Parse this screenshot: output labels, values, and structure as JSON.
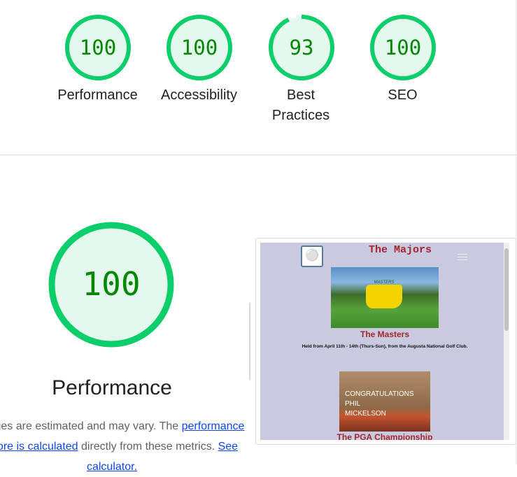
{
  "colors": {
    "pass": "#0cce6b",
    "pass_fill": "#e5f8ed",
    "pass_text": "#008800",
    "link": "#0d47f0"
  },
  "summary": [
    {
      "label": "Performance",
      "score": 100
    },
    {
      "label": "Accessibility",
      "score": 100
    },
    {
      "label": "Best Practices",
      "score": 93
    },
    {
      "label": "SEO",
      "score": 100
    }
  ],
  "detail": {
    "score": 100,
    "title": "Performance",
    "desc_prefix": "Values are estimated and may vary. The ",
    "link1": "performance score is calculated",
    "desc_middle": " directly from these metrics. ",
    "link2": "See calculator."
  },
  "screenshot": {
    "site_title": "The Majors",
    "logo_icon": "golf-ball-icon",
    "section1_title": "The Masters",
    "section1_text": "Held from April 11th - 14th (Thurs-Sun), from the Augusta National Golf Club.",
    "section1_image_text": "MASTERS",
    "section2_image_text": "CONGRATULATIONS PHIL MICKELSON",
    "section2_title": "The PGA Championship"
  }
}
